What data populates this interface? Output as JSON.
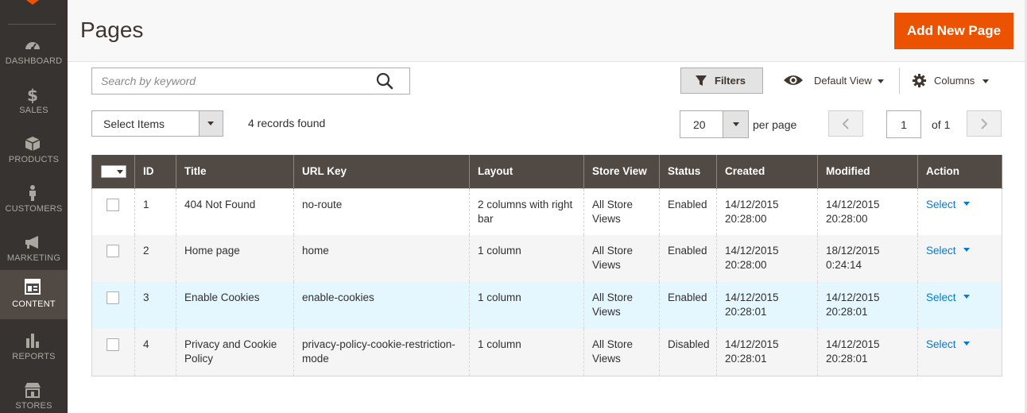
{
  "sidebar": {
    "items": [
      {
        "label": "DASHBOARD",
        "icon": "dashboard-icon"
      },
      {
        "label": "SALES",
        "icon": "dollar-icon"
      },
      {
        "label": "PRODUCTS",
        "icon": "box-icon"
      },
      {
        "label": "CUSTOMERS",
        "icon": "person-icon"
      },
      {
        "label": "MARKETING",
        "icon": "megaphone-icon"
      },
      {
        "label": "CONTENT",
        "icon": "layout-icon"
      },
      {
        "label": "REPORTS",
        "icon": "bar-chart-icon"
      },
      {
        "label": "STORES",
        "icon": "storefront-icon"
      }
    ],
    "active": "CONTENT"
  },
  "header": {
    "title": "Pages",
    "add_button": "Add New Page"
  },
  "search": {
    "placeholder": "Search by keyword",
    "value": ""
  },
  "toolbar": {
    "filters_label": "Filters",
    "view_label": "Default View",
    "columns_label": "Columns",
    "mass_action_label": "Select Items",
    "records_found": "4 records found"
  },
  "pagination": {
    "per_page_value": "20",
    "per_page_label": "per page",
    "current_page": "1",
    "total_label": "of 1"
  },
  "table": {
    "headers": {
      "id": "ID",
      "title": "Title",
      "url_key": "URL Key",
      "layout": "Layout",
      "store_view": "Store View",
      "status": "Status",
      "created": "Created",
      "modified": "Modified",
      "action": "Action"
    },
    "rows": [
      {
        "id": "1",
        "title": "404 Not Found",
        "url_key": "no-route",
        "layout": "2 columns with right bar",
        "store_view": "All Store Views",
        "status": "Enabled",
        "created": "14/12/2015 20:28:00",
        "modified": "14/12/2015 20:28:00",
        "action": "Select"
      },
      {
        "id": "2",
        "title": "Home page",
        "url_key": "home",
        "layout": "1 column",
        "store_view": "All Store Views",
        "status": "Enabled",
        "created": "14/12/2015 20:28:00",
        "modified": "18/12/2015 0:24:14",
        "action": "Select"
      },
      {
        "id": "3",
        "title": "Enable Cookies",
        "url_key": "enable-cookies",
        "layout": "1 column",
        "store_view": "All Store Views",
        "status": "Enabled",
        "created": "14/12/2015 20:28:01",
        "modified": "14/12/2015 20:28:01",
        "action": "Select"
      },
      {
        "id": "4",
        "title": "Privacy and Cookie Policy",
        "url_key": "privacy-policy-cookie-restriction-mode",
        "layout": "1 column",
        "store_view": "All Store Views",
        "status": "Disabled",
        "created": "14/12/2015 20:28:01",
        "modified": "14/12/2015 20:28:01",
        "action": "Select"
      }
    ]
  },
  "colors": {
    "sidebar_bg": "#373330",
    "sidebar_active_bg": "#514943",
    "accent": "#eb5202",
    "table_header_bg": "#514943",
    "link": "#007bdb",
    "row_highlight": "#e5f7fe"
  }
}
